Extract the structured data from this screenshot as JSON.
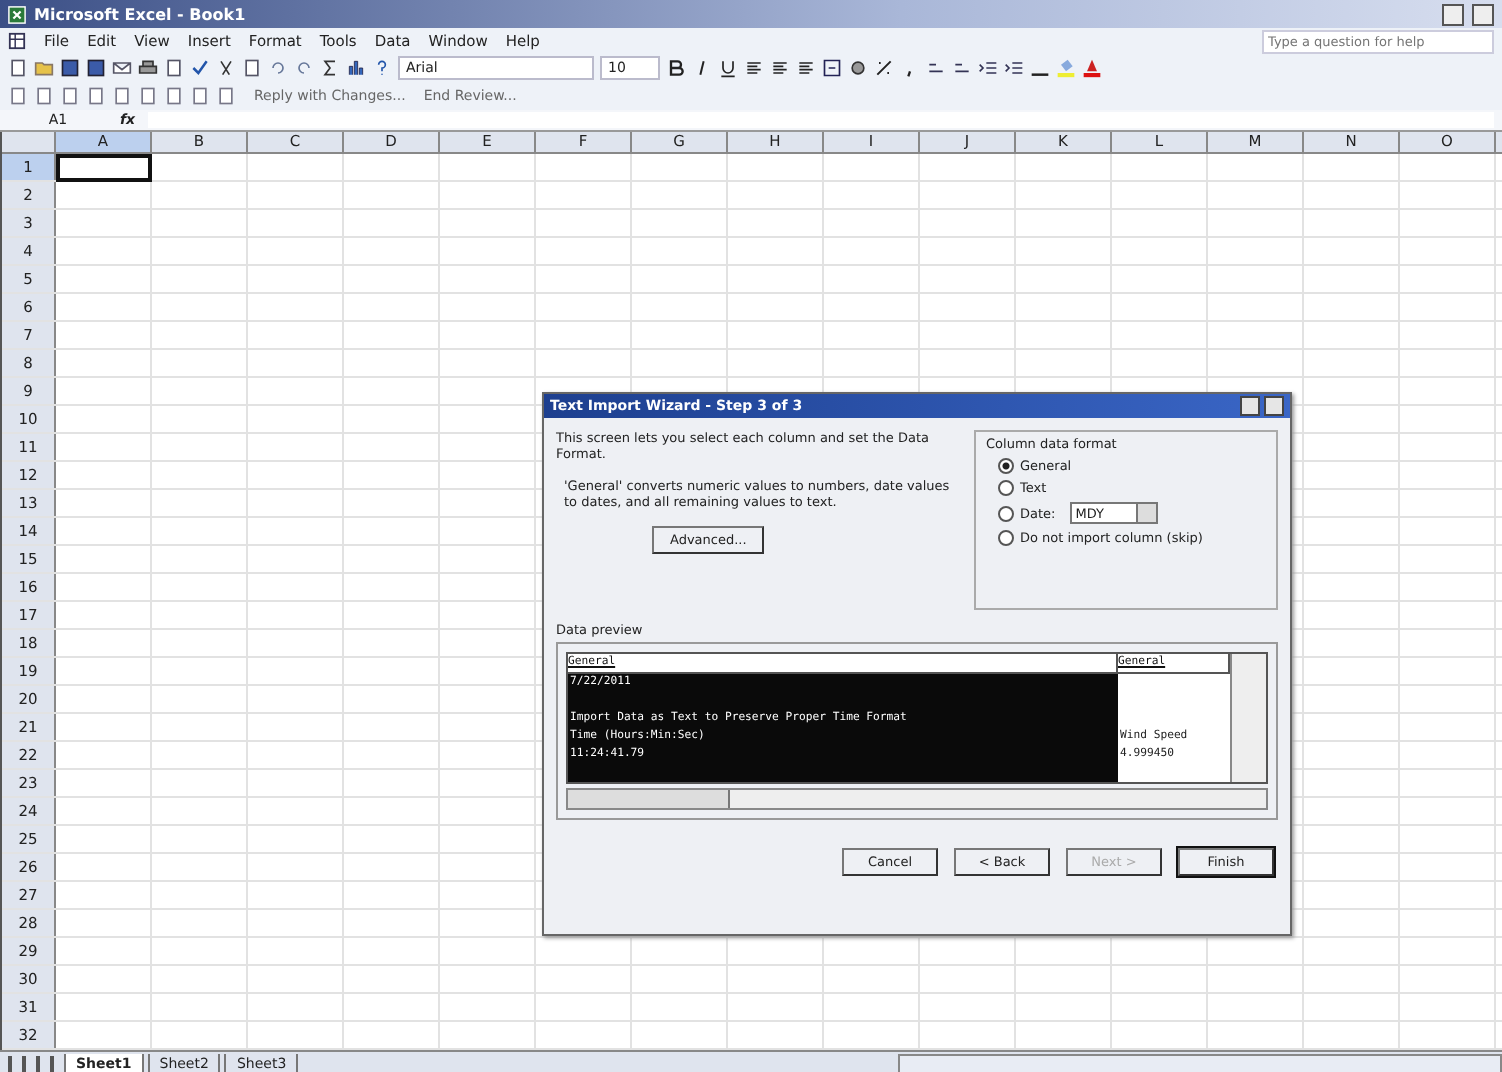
{
  "window": {
    "title": "Microsoft Excel - Book1"
  },
  "menu": [
    "File",
    "Edit",
    "View",
    "Insert",
    "Format",
    "Tools",
    "Data",
    "Window",
    "Help"
  ],
  "help_box": {
    "placeholder": "Type a question for help"
  },
  "toolbar": {
    "font": "Arial",
    "size": "10"
  },
  "review_toolbar": [
    "Reply with Changes...",
    "End Review..."
  ],
  "formula_bar": {
    "name_box": "A1",
    "fx": "fx"
  },
  "sheet": {
    "columns": [
      {
        "label": "A",
        "selected": true
      },
      {
        "label": "B",
        "selected": false
      },
      {
        "label": "C",
        "selected": false
      },
      {
        "label": "D",
        "selected": false
      },
      {
        "label": "E",
        "selected": false
      },
      {
        "label": "F",
        "selected": false
      },
      {
        "label": "G",
        "selected": false
      },
      {
        "label": "H",
        "selected": false
      },
      {
        "label": "I",
        "selected": false
      },
      {
        "label": "J",
        "selected": false
      },
      {
        "label": "K",
        "selected": false
      },
      {
        "label": "L",
        "selected": false
      },
      {
        "label": "M",
        "selected": false
      },
      {
        "label": "N",
        "selected": false
      },
      {
        "label": "O",
        "selected": false
      }
    ],
    "rows": [
      {
        "label": "1",
        "selected": true
      },
      {
        "label": "2",
        "selected": false
      },
      {
        "label": "3",
        "selected": false
      },
      {
        "label": "4",
        "selected": false
      },
      {
        "label": "5",
        "selected": false
      },
      {
        "label": "6",
        "selected": false
      },
      {
        "label": "7",
        "selected": false
      },
      {
        "label": "8",
        "selected": false
      },
      {
        "label": "9",
        "selected": false
      },
      {
        "label": "10",
        "selected": false
      },
      {
        "label": "11",
        "selected": false
      },
      {
        "label": "12",
        "selected": false
      },
      {
        "label": "13",
        "selected": false
      },
      {
        "label": "14",
        "selected": false
      },
      {
        "label": "15",
        "selected": false
      },
      {
        "label": "16",
        "selected": false
      },
      {
        "label": "17",
        "selected": false
      },
      {
        "label": "18",
        "selected": false
      },
      {
        "label": "19",
        "selected": false
      },
      {
        "label": "20",
        "selected": false
      },
      {
        "label": "21",
        "selected": false
      },
      {
        "label": "22",
        "selected": false
      },
      {
        "label": "23",
        "selected": false
      },
      {
        "label": "24",
        "selected": false
      },
      {
        "label": "25",
        "selected": false
      },
      {
        "label": "26",
        "selected": false
      },
      {
        "label": "27",
        "selected": false
      },
      {
        "label": "28",
        "selected": false
      },
      {
        "label": "29",
        "selected": false
      },
      {
        "label": "30",
        "selected": false
      },
      {
        "label": "31",
        "selected": false
      },
      {
        "label": "32",
        "selected": false
      }
    ]
  },
  "dialog": {
    "title": "Text Import Wizard - Step 3 of 3",
    "intro": "This screen lets you select each column and set the Data Format.",
    "note": "'General' converts numeric values to numbers, date values to dates, and all remaining values to text.",
    "advanced_button": "Advanced...",
    "format_group": {
      "title": "Column data format",
      "options": [
        {
          "label": "General",
          "selected": true
        },
        {
          "label": "Text",
          "selected": false
        },
        {
          "label": "Date:",
          "selected": false,
          "dropdown": "MDY"
        },
        {
          "label": "Do not import column (skip)",
          "selected": false
        }
      ]
    },
    "preview": {
      "title": "Data preview",
      "columns": [
        {
          "header": "General",
          "selected": true
        },
        {
          "header": "General",
          "selected": false
        }
      ],
      "rows": [
        {
          "kind": "text",
          "cells": [
            "7/22/2011"
          ]
        },
        {
          "kind": "blank"
        },
        {
          "kind": "text",
          "cells": [
            "Import Data as Text to Preserve Proper Time Format"
          ]
        },
        {
          "kind": "text",
          "cells": [
            "Time (Hours:Min:Sec)",
            "Wind Speed"
          ]
        },
        {
          "kind": "text",
          "cells": [
            "11:24:41.79",
            "4.999450"
          ]
        }
      ]
    },
    "buttons": [
      {
        "label": "Cancel",
        "disabled": false,
        "default": false
      },
      {
        "label": "< Back",
        "disabled": false,
        "default": false
      },
      {
        "label": "Next >",
        "disabled": true,
        "default": false
      },
      {
        "label": "Finish",
        "disabled": false,
        "default": true
      }
    ]
  },
  "sheet_tabs": [
    {
      "label": "Sheet1",
      "selected": true
    },
    {
      "label": "Sheet2",
      "selected": false
    },
    {
      "label": "Sheet3",
      "selected": false
    }
  ]
}
